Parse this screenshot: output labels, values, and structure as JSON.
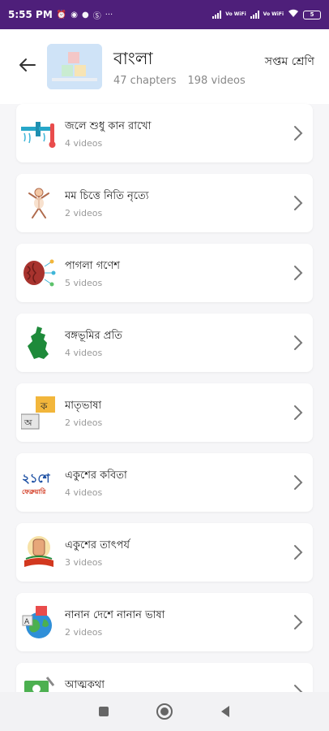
{
  "status_bar": {
    "time": "5:55 PM",
    "battery": "5",
    "net1": "Vo WiFi",
    "net2": "Vo WiFi"
  },
  "header": {
    "title": "বাংলা",
    "chapters": "47 chapters",
    "videos": "198 videos",
    "class_label": "সপ্তম শ্রেণি"
  },
  "chapters": [
    {
      "title": "জলে শুধু কান রাখো",
      "videos": "4 videos",
      "icon": "water-pipe-icon"
    },
    {
      "title": "মম চিত্তে নিতি নৃত্যে",
      "videos": "2 videos",
      "icon": "dancing-child-icon"
    },
    {
      "title": "পাগলা গণেশ",
      "videos": "5 videos",
      "icon": "brain-network-icon"
    },
    {
      "title": "বঙ্গভূমির প্রতি",
      "videos": "4 videos",
      "icon": "bengal-map-icon"
    },
    {
      "title": "মাতৃভাষা",
      "videos": "2 videos",
      "icon": "language-cards-icon"
    },
    {
      "title": "একুশের কবিতা",
      "videos": "4 videos",
      "icon": "ekushe-text-icon"
    },
    {
      "title": "একুশের তাৎপর্য",
      "videos": "3 videos",
      "icon": "raised-fist-book-icon"
    },
    {
      "title": "নানান দেশে নানান ভাষা",
      "videos": "2 videos",
      "icon": "globe-languages-icon"
    },
    {
      "title": "আত্মকথা",
      "videos": "",
      "icon": "writing-board-icon"
    }
  ],
  "ekushe_text": {
    "top": "২১শে",
    "bottom": "ফেব্রুয়ারি"
  },
  "lang_letters": {
    "a": "অ",
    "b": "A",
    "c": "ক"
  },
  "colors": {
    "status_bar": "#4e1f7a",
    "background": "#f6f6f8",
    "card": "#ffffff"
  }
}
